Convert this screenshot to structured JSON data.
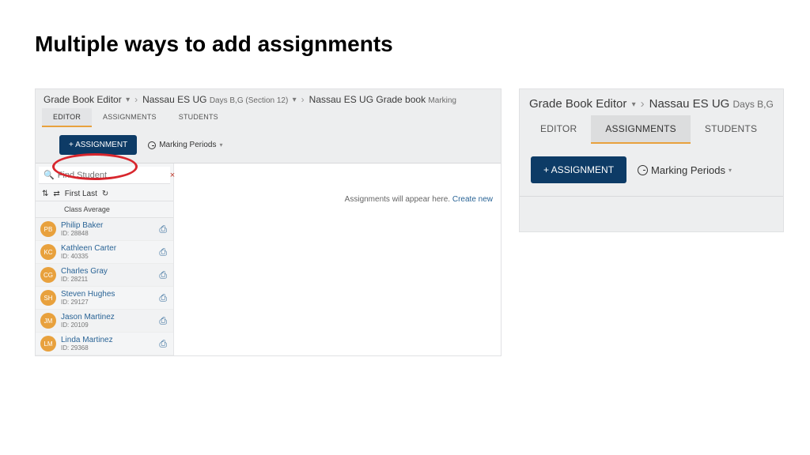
{
  "slide_title": "Multiple ways to add assignments",
  "left": {
    "breadcrumb": {
      "a": "Grade Book Editor",
      "b": "Nassau ES UG",
      "b_sub": "Days B,G (Section 12)",
      "c": "Nassau ES UG Grade book",
      "c_sub": "Marking"
    },
    "tabs": {
      "editor": "EDITOR",
      "assignments": "ASSIGNMENTS",
      "students": "STUDENTS"
    },
    "assignment_btn": "+ ASSIGNMENT",
    "marking_periods": "Marking Periods",
    "search_placeholder": "Find Student",
    "first_last": "First Last",
    "class_average": "Class Average",
    "empty_msg": "Assignments will appear here. ",
    "create_new": "Create new",
    "students": [
      {
        "initials": "PB",
        "name": "Philip Baker",
        "id": "ID: 28848"
      },
      {
        "initials": "KC",
        "name": "Kathleen Carter",
        "id": "ID: 40335"
      },
      {
        "initials": "CG",
        "name": "Charles Gray",
        "id": "ID: 28211"
      },
      {
        "initials": "SH",
        "name": "Steven Hughes",
        "id": "ID: 29127"
      },
      {
        "initials": "JM",
        "name": "Jason Martinez",
        "id": "ID: 20109"
      },
      {
        "initials": "LM",
        "name": "Linda Martinez",
        "id": "ID: 29368"
      }
    ]
  },
  "right": {
    "breadcrumb": {
      "a": "Grade Book Editor",
      "b": "Nassau ES UG",
      "b_sub": "Days B,G"
    },
    "tabs": {
      "editor": "EDITOR",
      "assignments": "ASSIGNMENTS",
      "students": "STUDENTS"
    },
    "assignment_btn": "+ ASSIGNMENT",
    "marking_periods": "Marking Periods"
  }
}
